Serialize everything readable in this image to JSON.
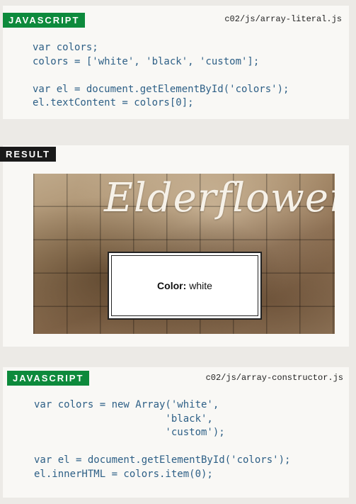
{
  "example1": {
    "tag": "JAVASCRIPT",
    "path": "c02/js/array-literal.js",
    "code": "var colors;\ncolors = ['white', 'black', 'custom'];\n\nvar el = document.getElementById('colors');\nel.textContent = colors[0];"
  },
  "result": {
    "tag": "RESULT",
    "logo": "Elderflower",
    "label": "Color:",
    "value": "white"
  },
  "example2": {
    "tag": "JAVASCRIPT",
    "path": "c02/js/array-constructor.js",
    "code": "var colors = new Array('white',\n                      'black',\n                      'custom');\n\nvar el = document.getElementById('colors');\nel.innerHTML = colors.item(0);"
  },
  "colors": {
    "tag_green": "#0d8a3c",
    "tag_dark": "#1a1a1a",
    "code_text": "#2d5f86"
  }
}
